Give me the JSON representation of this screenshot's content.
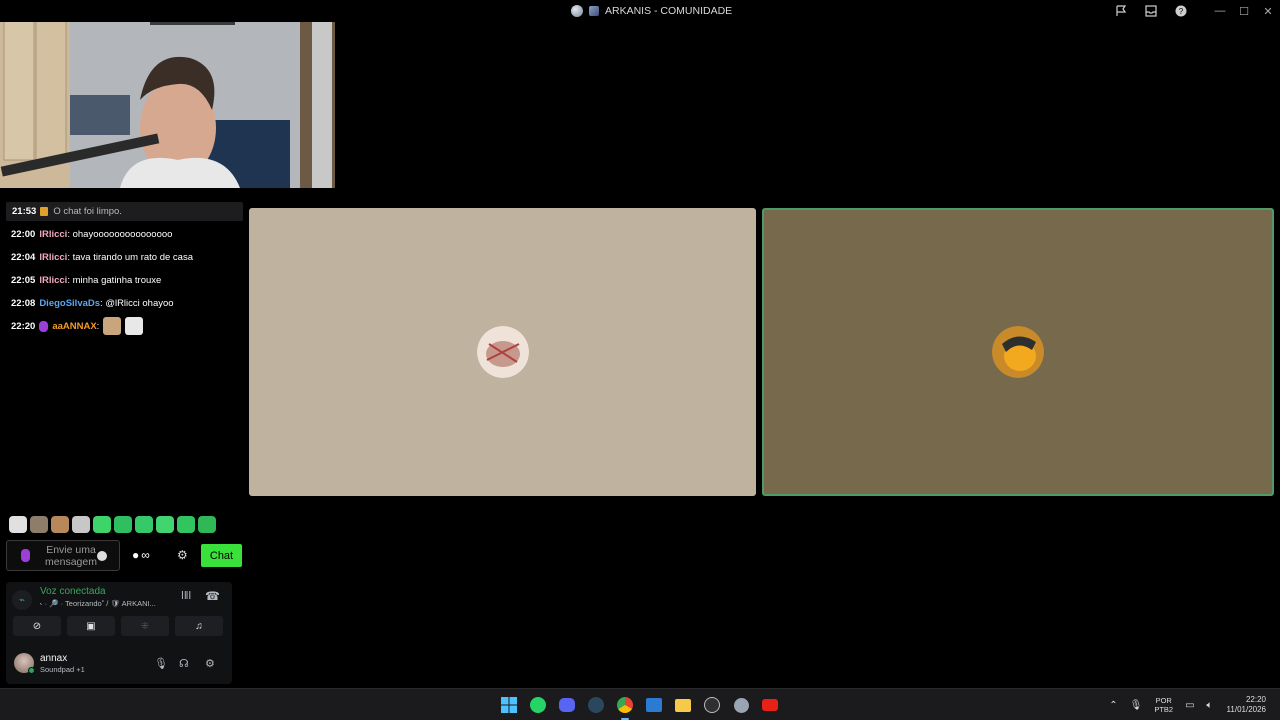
{
  "window": {
    "title": "ARKANIS - COMUNIDADE",
    "controls": {
      "minimize": "—",
      "maximize": "☐",
      "close": "✕"
    }
  },
  "chat": {
    "cleared": {
      "time": "21:53",
      "text": "O chat foi limpo."
    },
    "messages": [
      {
        "time": "22:00",
        "user": "lRlicci",
        "text": "ohayooooooooooooooo",
        "color": "#f2a7c3"
      },
      {
        "time": "22:04",
        "user": "lRlicci",
        "text": "tava tirando um rato de casa",
        "color": "#f2a7c3"
      },
      {
        "time": "22:05",
        "user": "lRlicci",
        "text": "minha gatinha trouxe",
        "color": "#f2a7c3"
      },
      {
        "time": "22:08",
        "user": "DiegoSilvaDs",
        "text": "@lRlicci ohayoo",
        "color": "#5aa6f2"
      },
      {
        "time": "22:20",
        "user": "aaANNAX",
        "text": "",
        "color": "#f39a2a"
      }
    ],
    "input": {
      "placeholder_line1": "Envie uma",
      "placeholder_line2": "mensagem"
    },
    "points_label": "∞",
    "chat_button": "Chat"
  },
  "voice": {
    "status": "Voz conectada",
    "channel": "˞ · 🔎 · Teorizando˚ / 🛡 ARKANI...",
    "user": {
      "name": "annax",
      "sub": "Soundpad +1"
    }
  },
  "taskbar": {
    "lang_line1": "POR",
    "lang_line2": "PTB2",
    "time": "22:20",
    "date": "11/01/2026"
  },
  "colors": {
    "accent_green": "#3ae13a",
    "voice_green": "#3ba55d",
    "tile1_bg": "#bfb29e",
    "tile2_bg": "#776a4c",
    "speaking_border": "#4f9a6a"
  }
}
